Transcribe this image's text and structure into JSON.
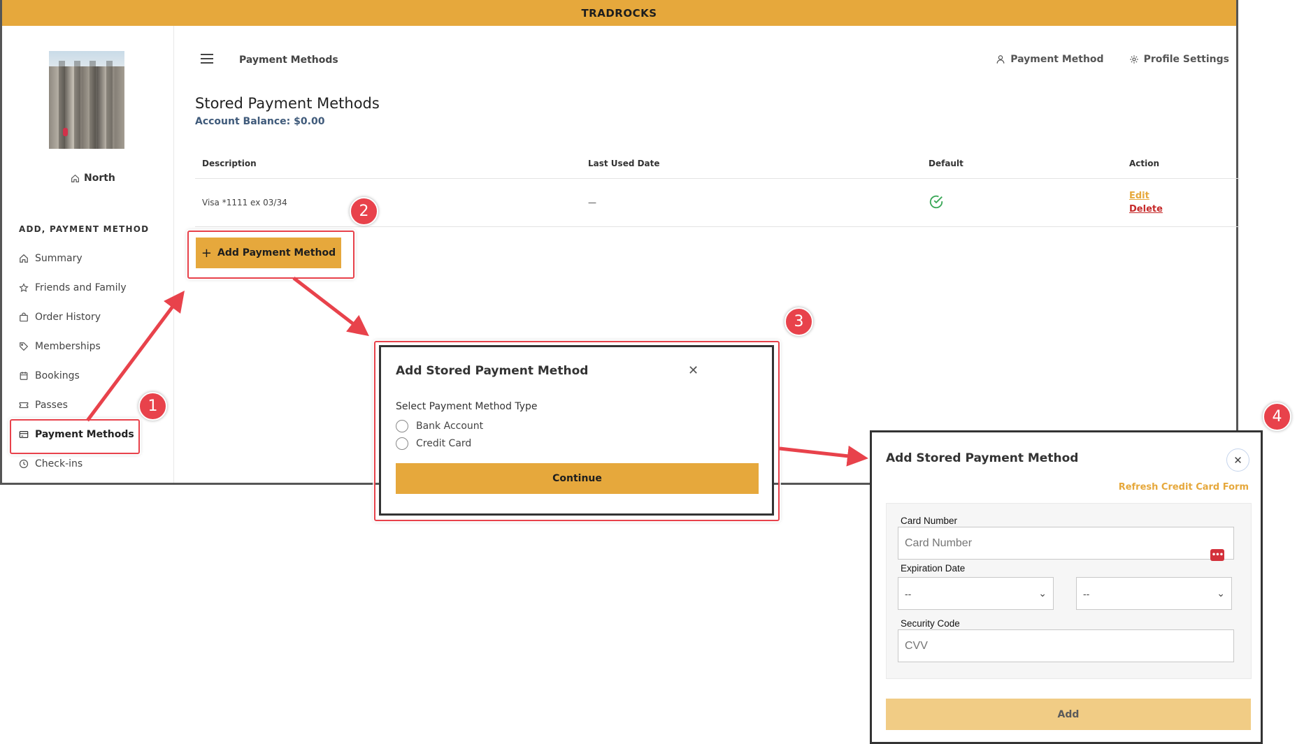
{
  "app": {
    "title": "TRADROCKS"
  },
  "sidebar": {
    "location": "North",
    "heading": "ADD, PAYMENT METHOD",
    "items": [
      {
        "label": "Summary",
        "icon": "home-icon"
      },
      {
        "label": "Friends and Family",
        "icon": "star-icon"
      },
      {
        "label": "Order History",
        "icon": "shopping-bag-icon"
      },
      {
        "label": "Memberships",
        "icon": "tag-icon"
      },
      {
        "label": "Bookings",
        "icon": "calendar-icon"
      },
      {
        "label": "Passes",
        "icon": "ticket-icon"
      },
      {
        "label": "Payment Methods",
        "icon": "credit-card-icon",
        "active": true
      },
      {
        "label": "Check-ins",
        "icon": "clock-icon"
      }
    ]
  },
  "header": {
    "breadcrumb": "Payment Methods",
    "links": [
      {
        "label": "Payment Method",
        "icon": "user-icon"
      },
      {
        "label": "Profile Settings",
        "icon": "gear-icon"
      }
    ]
  },
  "main": {
    "title": "Stored Payment Methods",
    "balance": "Account Balance: $0.00",
    "table": {
      "columns": [
        "Description",
        "Last Used Date",
        "Default",
        "Action"
      ],
      "rows": [
        {
          "description": "Visa *1111 ex 03/34",
          "last_used": "—",
          "default": true,
          "actions": [
            "Edit",
            "Delete"
          ]
        }
      ]
    },
    "add_button": "Add Payment Method"
  },
  "dialog_select": {
    "title": "Add Stored Payment Method",
    "label": "Select Payment Method Type",
    "options": [
      "Bank Account",
      "Credit Card"
    ],
    "continue_label": "Continue"
  },
  "dialog_card": {
    "title": "Add Stored Payment Method",
    "refresh_label": "Refresh Credit Card Form",
    "card_number_label": "Card Number",
    "card_number_placeholder": "Card Number",
    "expiration_label": "Expiration Date",
    "exp_month_value": "--",
    "exp_year_value": "--",
    "security_label": "Security Code",
    "security_placeholder": "CVV",
    "add_label": "Add"
  },
  "callouts": [
    "1",
    "2",
    "3",
    "4"
  ],
  "colors": {
    "accent": "#e6a83c",
    "add_button_disabled": "#f1cc85",
    "delete": "#c62a2a",
    "balance": "#3f5a7a",
    "callout": "#e8424b",
    "check": "#3aa757"
  }
}
